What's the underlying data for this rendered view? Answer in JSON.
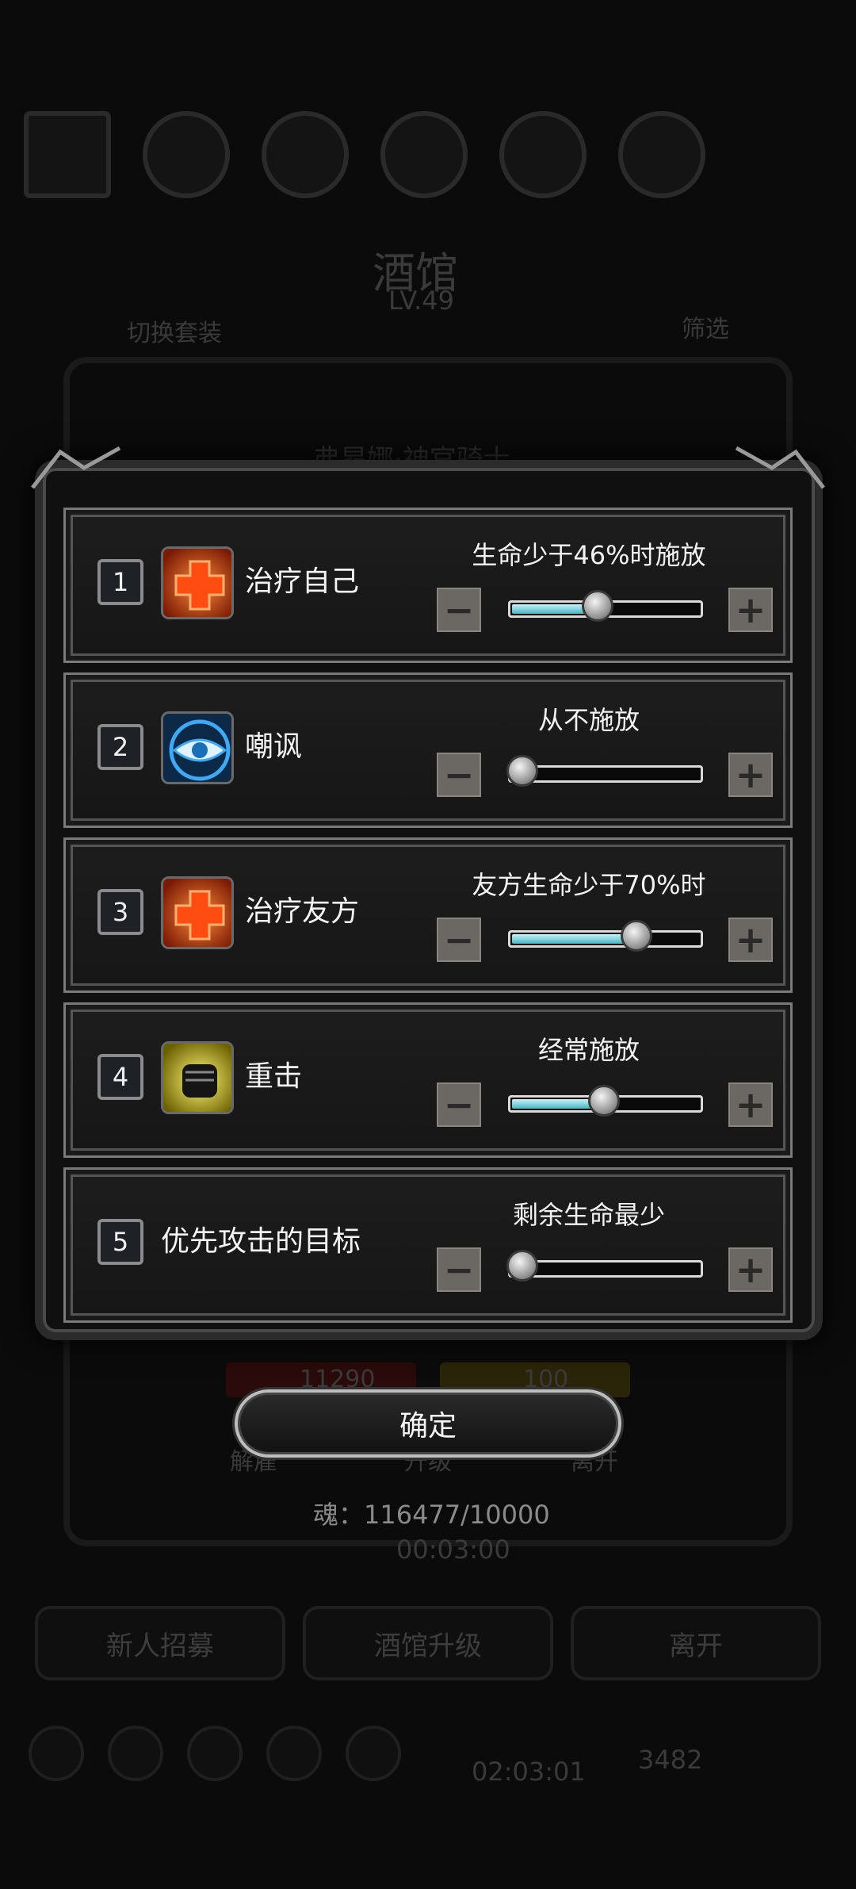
{
  "background": {
    "header_title": "酒馆",
    "level": "LV.49",
    "switch_label": "切换套装",
    "filter_label": "筛选",
    "hero_name": "弗昂娜·神官骑士",
    "hp_value": "11290",
    "energy_value": "100",
    "btn_a": "解雇",
    "btn_b": "升级",
    "btn_c": "离开",
    "soul_label": "魂：116477/10000",
    "timer": "00:03:00",
    "bottom_btn_1": "新人招募",
    "bottom_btn_2": "酒馆升级",
    "bottom_btn_3": "离开",
    "bottom_timer": "02:03:01",
    "coins": "3482"
  },
  "skills": [
    {
      "num": "1",
      "name": "治疗自己",
      "condition": "生命少于46%时施放",
      "icon": "heal-cross-icon",
      "level": 0.46
    },
    {
      "num": "2",
      "name": "嘲讽",
      "condition": "从不施放",
      "icon": "eye-icon",
      "level": 0.0
    },
    {
      "num": "3",
      "name": "治疗友方",
      "condition": "友方生命少于70%时",
      "icon": "heal-cross-icon",
      "level": 0.7
    },
    {
      "num": "4",
      "name": "重击",
      "condition": "经常施放",
      "icon": "fist-icon",
      "level": 0.5
    },
    {
      "num": "5",
      "name": "优先攻击的目标",
      "condition": "剩余生命最少",
      "icon": "",
      "level": 0.0
    }
  ],
  "buttons": {
    "minus": "−",
    "plus": "+"
  },
  "confirm_label": "确定",
  "colors": {
    "slider_fill": "#4bb3c4",
    "heal_orange": "#ff5a1a",
    "eye_blue": "#3fa9f5",
    "fist_yellow": "#e6d100"
  }
}
